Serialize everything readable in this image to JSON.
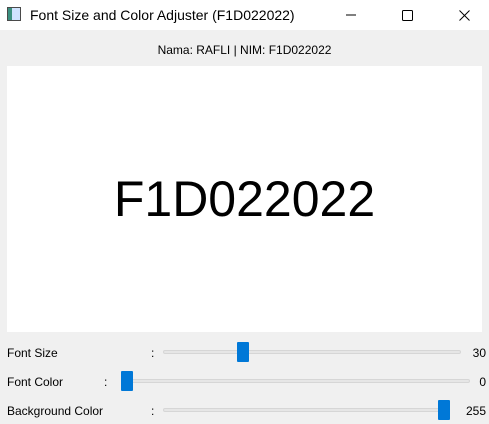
{
  "window": {
    "title": "Font Size and Color Adjuster (F1D022022)",
    "minimize_glyph": "minimize-icon",
    "maximize_glyph": "maximize-icon",
    "close_glyph": "close-icon"
  },
  "info_label": "Nama: RAFLI | NIM: F1D022022",
  "preview": {
    "text": "F1D022022",
    "text_color": "#000000",
    "background_color": "#ffffff"
  },
  "sliders": [
    {
      "label": "Font Size",
      "colon": ":",
      "value": "30",
      "fraction": 0.26
    },
    {
      "label": "Font Color",
      "colon": ":",
      "value": "0",
      "fraction": 0.0
    },
    {
      "label": "Background Color",
      "colon": ":",
      "value": "255",
      "fraction": 1.0
    }
  ],
  "colors": {
    "accent": "#0078d7",
    "window_bg": "#f0f0f0",
    "titlebar_bg": "#ffffff"
  }
}
